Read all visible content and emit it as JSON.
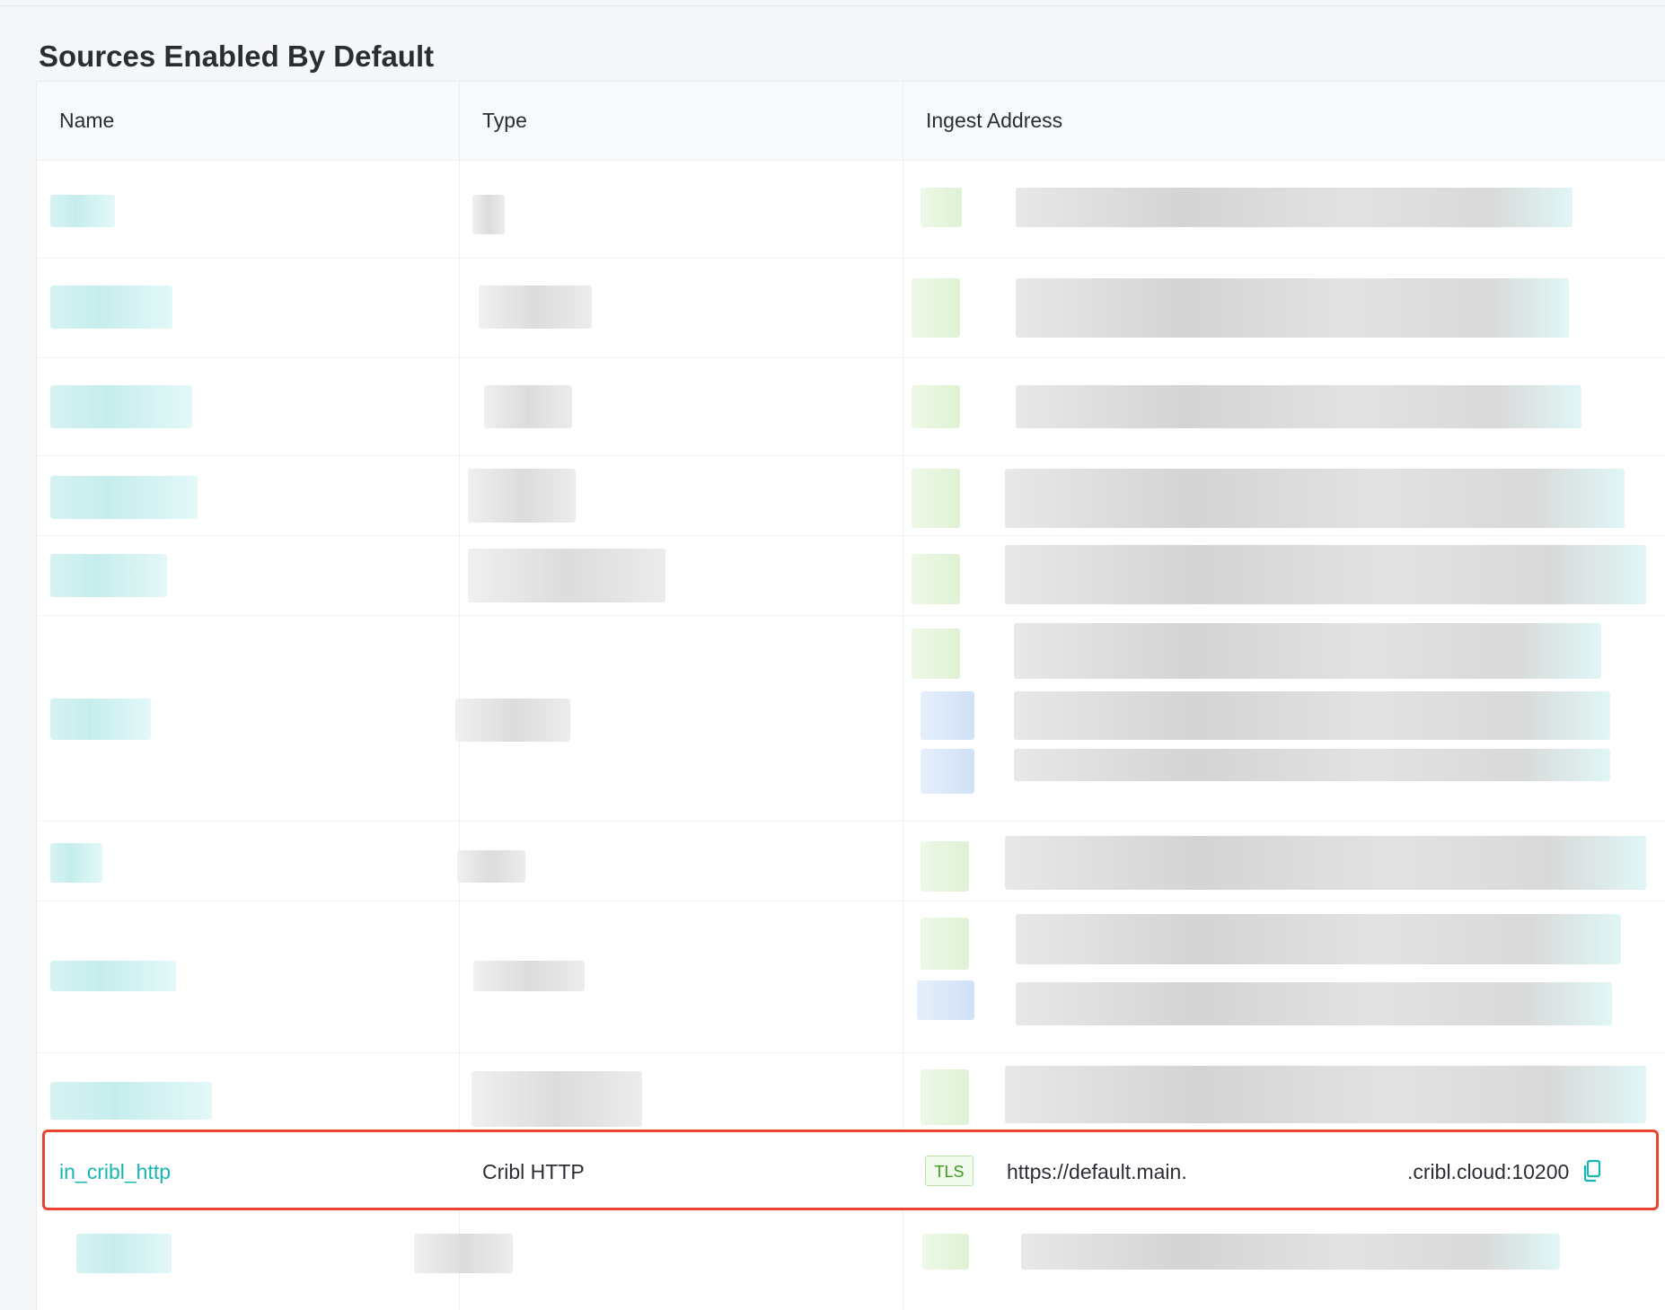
{
  "section": {
    "title": "Sources Enabled By Default"
  },
  "table": {
    "columns": [
      "Name",
      "Type",
      "Ingest Address"
    ],
    "highlighted_row": {
      "name": "in_cribl_http",
      "type": "Cribl HTTP",
      "badge": "TLS",
      "address_start": "https://default.main.",
      "address_end": ".cribl.cloud:10200"
    }
  },
  "colors": {
    "link": "#16b5b0",
    "highlight_border": "#e8432e",
    "tls_badge": "#3d9a1f"
  },
  "icons": {
    "copy": "copy-icon"
  }
}
